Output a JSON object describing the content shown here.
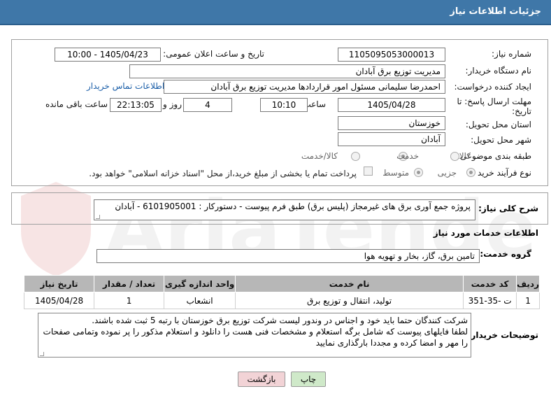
{
  "header": {
    "title": "جزئیات اطلاعات نیاز"
  },
  "form": {
    "need_number_label": "شماره نیاز:",
    "need_number": "1105095053000013",
    "announce_label": "تاریخ و ساعت اعلان عمومی:",
    "announce_value": "1405/04/23 - 10:00",
    "buyer_org_label": "نام دستگاه خریدار:",
    "buyer_org": "مدیریت توزیع برق آبادان",
    "creator_label": "ایجاد کننده درخواست:",
    "creator": "احمدرضا سلیمانی مسئول امور قراردادها مدیریت توزیع برق آبادان",
    "contact_link": "اطلاعات تماس خریدار",
    "deadline_label": "مهلت ارسال پاسخ: تا تاریخ:",
    "deadline_date": "1405/04/28",
    "time_label": "ساعت",
    "deadline_time": "10:10",
    "days_value": "4",
    "days_label": "روز و",
    "remaining_time": "22:13:05",
    "remaining_label": "ساعت باقی مانده",
    "province_label": "استان محل تحویل:",
    "province": "خوزستان",
    "city_label": "شهر محل تحویل:",
    "city": "آبادان",
    "category_label": "طبقه بندی موضوعی:",
    "category_options": [
      "کالا",
      "خدمت",
      "کالا/خدمت"
    ],
    "category_selected": "خدمت",
    "process_label": "نوع فرآیند خرید :",
    "process_options": [
      "جزیی",
      "متوسط"
    ],
    "process_selected": "جزیی",
    "payment_note": "پرداخت تمام یا بخشی از مبلغ خرید،از محل \"اسناد خزانه اسلامی\" خواهد بود."
  },
  "summary": {
    "label": "شرح کلی نیاز:",
    "value": "پروژه جمع آوری برق های غیرمجاز (پلیس برق) طبق فرم پیوست - دستورکار : 6101905001 - آبادان"
  },
  "services": {
    "section_title": "اطلاعات خدمات مورد نیاز",
    "group_label": "گروه خدمت:",
    "group_value": "تامین برق، گاز، بخار و تهویه هوا",
    "columns": [
      "ردیف",
      "کد خدمت",
      "نام خدمت",
      "واحد اندازه گیری",
      "تعداد / مقدار",
      "تاریخ نیاز"
    ],
    "rows": [
      [
        "1",
        "ت -35-351",
        "تولید، انتقال و توزیع برق",
        "انشعاب",
        "1",
        "1405/04/28"
      ]
    ]
  },
  "buyer_notes": {
    "label": "توضیحات خریدار:",
    "text": "شرکت کنندگان حتما باید خود و اجناس در وندور لیست شرکت توزیع برق خوزستان با رتبه 5 ثبت شده باشند.\nلطفا فایلهای پیوست که شامل برگه استعلام و مشخصات فنی هست را دانلود و استعلام مذکور را پر نموده وتمامی صفحات را مهر و امضا کرده و مجددا بارگذاری نمایید"
  },
  "buttons": {
    "print": "چاپ",
    "back": "بازگشت"
  },
  "watermark": {
    "text": "AriaTender.net"
  },
  "colors": {
    "header_bg": "#3f77a8",
    "table_header": "#b7b7b7",
    "print_btn": "#cfe9c9",
    "back_btn": "#f2d3d6"
  }
}
